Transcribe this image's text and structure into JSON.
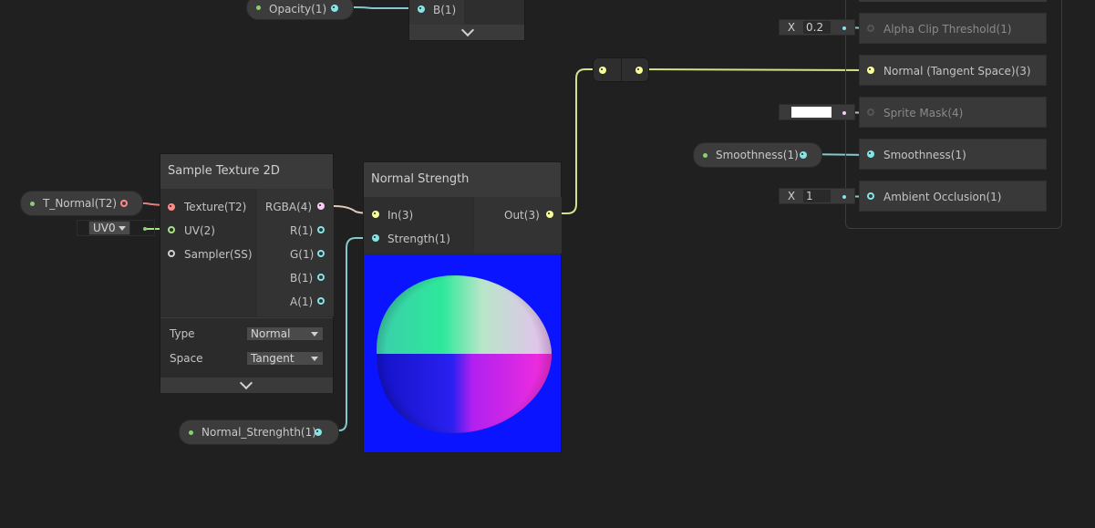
{
  "properties": {
    "opacity": "Opacity(1)",
    "t_normal": "T_Normal(T2)",
    "smoothness": "Smoothness(1)",
    "normal_strength": "Normal_Strenghth(1)"
  },
  "uv_dropdown": {
    "value": "UV0"
  },
  "partial_node": {
    "b_label": "B(1)"
  },
  "sample_texture": {
    "title": "Sample Texture 2D",
    "inputs": [
      "Texture(T2)",
      "UV(2)",
      "Sampler(SS)"
    ],
    "outputs": [
      "RGBA(4)",
      "R(1)",
      "G(1)",
      "B(1)",
      "A(1)"
    ],
    "type_label": "Type",
    "type_value": "Normal",
    "space_label": "Space",
    "space_value": "Tangent"
  },
  "normal_strength_node": {
    "title": "Normal Strength",
    "in_label": "In(3)",
    "strength_label": "Strength(1)",
    "out_label": "Out(3)"
  },
  "master": {
    "alpha_clip": {
      "label": "Alpha Clip Threshold(1)",
      "axis": "X",
      "value": "0.2"
    },
    "normal": {
      "label": "Normal (Tangent Space)(3)"
    },
    "sprite_mask": {
      "label": "Sprite Mask(4)"
    },
    "smoothness": {
      "label": "Smoothness(1)"
    },
    "ambient_occlusion": {
      "label": "Ambient Occlusion(1)",
      "axis": "X",
      "value": "1"
    }
  },
  "colors": {
    "background": "#202020",
    "float_port": "#84e4e7",
    "vector3_port": "#f6ff9a",
    "texture_port": "#ff8b8b",
    "vector4_port": "#fbcbf4",
    "property_dot": "#8bd16a"
  }
}
